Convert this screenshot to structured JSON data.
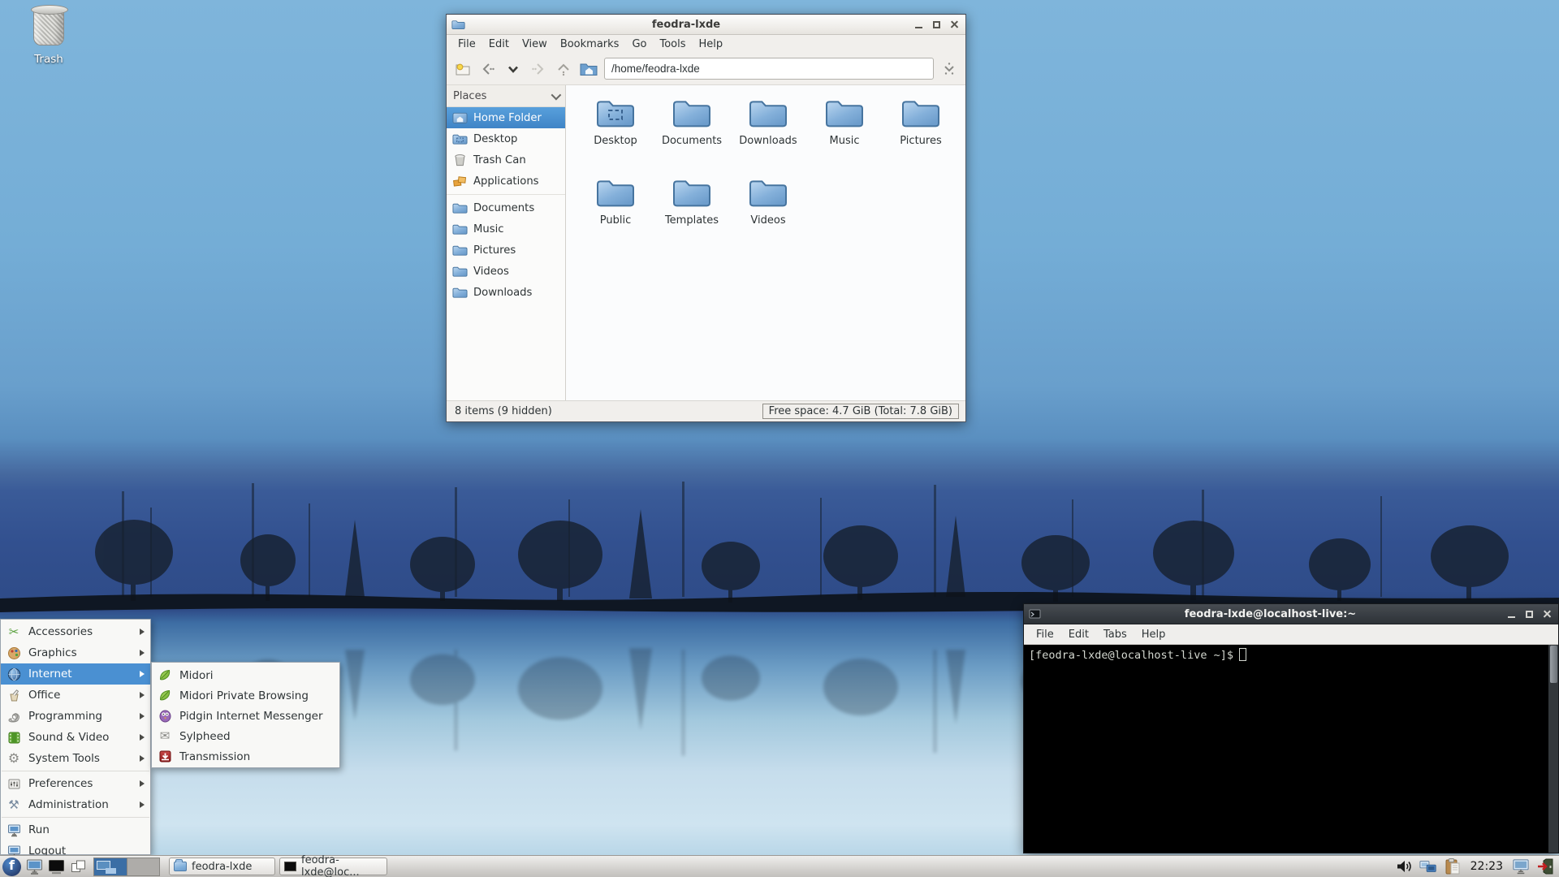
{
  "desktop": {
    "trash_label": "Trash"
  },
  "file_manager": {
    "title": "feodra-lxde",
    "menu_items": [
      "File",
      "Edit",
      "View",
      "Bookmarks",
      "Go",
      "Tools",
      "Help"
    ],
    "address": "/home/feodra-lxde",
    "sidebar": {
      "header": "Places",
      "items": [
        {
          "label": "Home Folder",
          "icon": "home-folder"
        },
        {
          "label": "Desktop",
          "icon": "desktop-folder"
        },
        {
          "label": "Trash Can",
          "icon": "trash-can"
        },
        {
          "label": "Applications",
          "icon": "applications"
        },
        {
          "label": "Documents",
          "icon": "folder"
        },
        {
          "label": "Music",
          "icon": "folder"
        },
        {
          "label": "Pictures",
          "icon": "folder"
        },
        {
          "label": "Videos",
          "icon": "folder"
        },
        {
          "label": "Downloads",
          "icon": "folder"
        }
      ]
    },
    "folders": [
      "Desktop",
      "Documents",
      "Downloads",
      "Music",
      "Pictures",
      "Public",
      "Templates",
      "Videos"
    ],
    "status_left": "8 items (9 hidden)",
    "status_right": "Free space: 4.7 GiB (Total: 7.8 GiB)"
  },
  "app_menu": {
    "items": [
      {
        "label": "Accessories",
        "icon": "accessories"
      },
      {
        "label": "Graphics",
        "icon": "graphics"
      },
      {
        "label": "Internet",
        "icon": "internet"
      },
      {
        "label": "Office",
        "icon": "office"
      },
      {
        "label": "Programming",
        "icon": "programming"
      },
      {
        "label": "Sound & Video",
        "icon": "sound-video"
      },
      {
        "label": "System Tools",
        "icon": "system-tools"
      },
      {
        "label": "Preferences",
        "icon": "preferences"
      },
      {
        "label": "Administration",
        "icon": "administration"
      },
      {
        "label": "Run",
        "icon": "run"
      },
      {
        "label": "Logout",
        "icon": "logout"
      }
    ]
  },
  "internet_submenu": {
    "items": [
      {
        "label": "Midori",
        "icon": "midori"
      },
      {
        "label": "Midori Private Browsing",
        "icon": "midori"
      },
      {
        "label": "Pidgin Internet Messenger",
        "icon": "pidgin"
      },
      {
        "label": "Sylpheed",
        "icon": "sylpheed"
      },
      {
        "label": "Transmission",
        "icon": "transmission"
      }
    ]
  },
  "terminal": {
    "title": "feodra-lxde@localhost-live:~",
    "menu_items": [
      "File",
      "Edit",
      "Tabs",
      "Help"
    ],
    "prompt": "[feodra-lxde@localhost-live ~]$"
  },
  "taskbar": {
    "start_glyph": "f",
    "window_buttons": [
      {
        "label": "feodra-lxde",
        "icon": "folder"
      },
      {
        "label": "feodra-lxde@loc...",
        "icon": "terminal"
      }
    ],
    "clock": "22:23"
  },
  "colors": {
    "selection_blue": "#4a90d2",
    "folder_blue": "#7fa8d0",
    "fedora_blue": "#294172",
    "terminal_bg": "#000000",
    "terminal_fg": "#d3d7cf",
    "taskbar_bg": "#cfcdca"
  }
}
